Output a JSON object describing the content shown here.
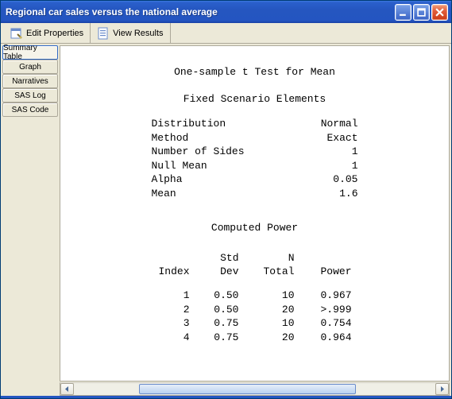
{
  "window": {
    "title": "Regional car sales versus the national average"
  },
  "toolbar": {
    "edit_properties": "Edit Properties",
    "view_results": "View Results"
  },
  "sidebar": {
    "items": [
      {
        "label": "Summary Table"
      },
      {
        "label": "Graph"
      },
      {
        "label": "Narratives"
      },
      {
        "label": "SAS Log"
      },
      {
        "label": "SAS Code"
      }
    ]
  },
  "report": {
    "title": "One-sample t Test for Mean",
    "scenario_title": "Fixed Scenario Elements",
    "scenario": [
      {
        "label": "Distribution",
        "value": "Normal"
      },
      {
        "label": "Method",
        "value": "Exact"
      },
      {
        "label": "Number of Sides",
        "value": "1"
      },
      {
        "label": "Null Mean",
        "value": "1"
      },
      {
        "label": "Alpha",
        "value": "0.05"
      },
      {
        "label": "Mean",
        "value": "1.6"
      }
    ],
    "computed_title": "Computed Power",
    "headers": {
      "index": "Index",
      "std1": "Std",
      "std2": "Dev",
      "n1": "N",
      "n2": "Total",
      "power": "Power"
    },
    "rows": [
      {
        "index": "1",
        "sd": "0.50",
        "n": "10",
        "power": "0.967"
      },
      {
        "index": "2",
        "sd": "0.50",
        "n": "20",
        "power": ">.999"
      },
      {
        "index": "3",
        "sd": "0.75",
        "n": "10",
        "power": "0.754"
      },
      {
        "index": "4",
        "sd": "0.75",
        "n": "20",
        "power": "0.964"
      }
    ]
  },
  "chart_data": {
    "type": "table",
    "title": "One-sample t Test for Mean — Computed Power",
    "columns": [
      "Index",
      "Std Dev",
      "N Total",
      "Power"
    ],
    "rows": [
      [
        1,
        0.5,
        10,
        0.967
      ],
      [
        2,
        0.5,
        20,
        0.999
      ],
      [
        3,
        0.75,
        10,
        0.754
      ],
      [
        4,
        0.75,
        20,
        0.964
      ]
    ],
    "parameters": {
      "Distribution": "Normal",
      "Method": "Exact",
      "Number of Sides": 1,
      "Null Mean": 1,
      "Alpha": 0.05,
      "Mean": 1.6
    }
  }
}
